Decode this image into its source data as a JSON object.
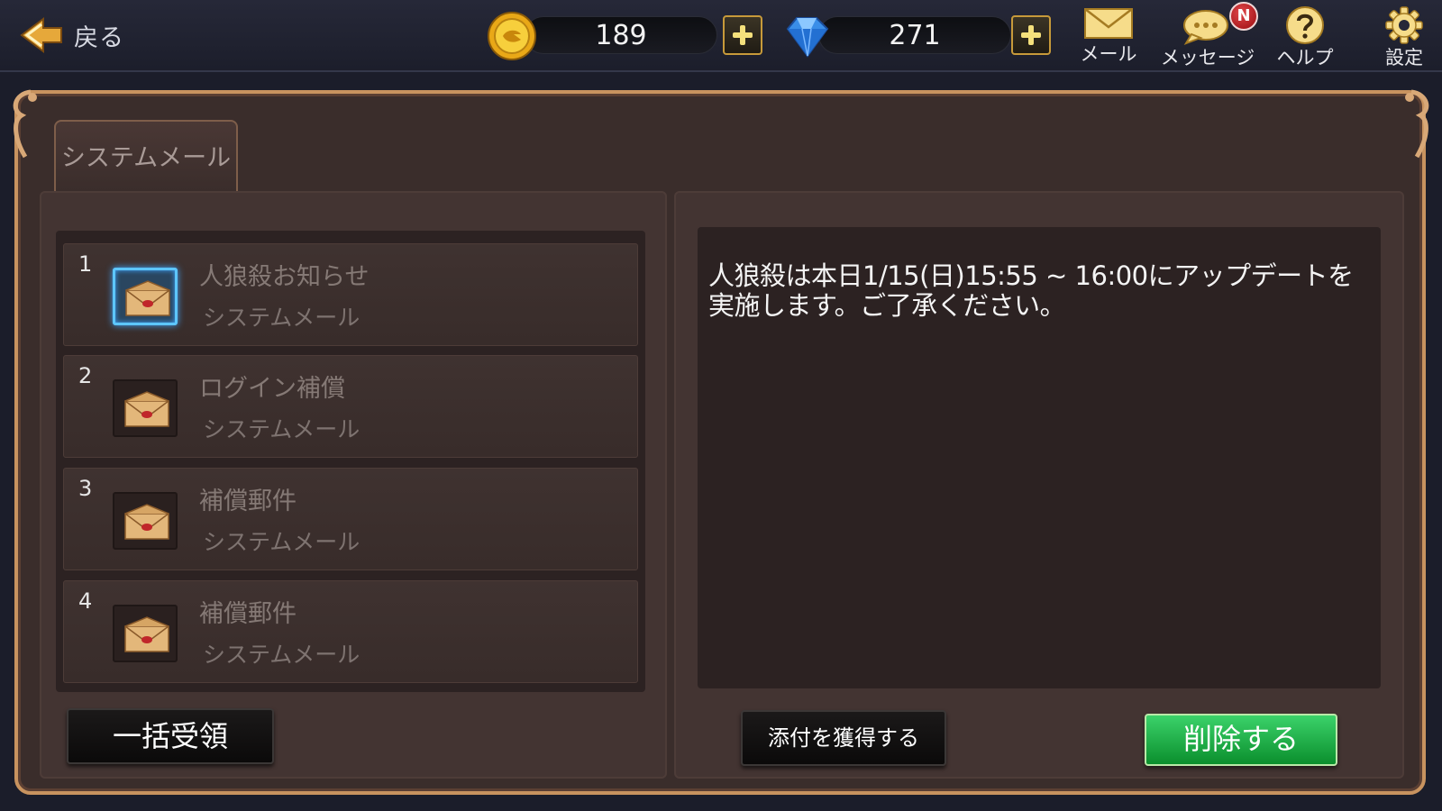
{
  "topbar": {
    "back_label": "戻る",
    "gold": "189",
    "gems": "271",
    "mail_label": "メール",
    "message_label": "メッセージ",
    "message_badge": "N",
    "help_label": "ヘルプ",
    "settings_label": "設定"
  },
  "tab": {
    "label": "システムメール"
  },
  "mails": [
    {
      "num": "1",
      "title": "人狼殺お知らせ",
      "sender": "システムメール",
      "selected": true
    },
    {
      "num": "2",
      "title": "ログイン補償",
      "sender": "システムメール",
      "selected": false
    },
    {
      "num": "3",
      "title": "補償郵件",
      "sender": "システムメール",
      "selected": false
    },
    {
      "num": "4",
      "title": "補償郵件",
      "sender": "システムメール",
      "selected": false
    }
  ],
  "detail": {
    "body": "人狼殺は本日1/15(日)15:55 ~ 16:00にアップデートを実施します。ご了承ください。"
  },
  "buttons": {
    "bulk_receive": "一括受領",
    "get_attachment": "添付を獲得する",
    "delete": "削除する"
  },
  "colors": {
    "frame_border": "#c8935f",
    "panel": "#433432",
    "selected_glow": "#5dc6ff",
    "delete_green": "#1ea845",
    "badge_red": "#c8191f"
  },
  "icons": [
    "back-arrow-icon",
    "gold-coin-icon",
    "gem-icon",
    "plus-icon",
    "mail-icon",
    "message-icon",
    "help-icon",
    "gear-icon",
    "envelope-icon"
  ]
}
